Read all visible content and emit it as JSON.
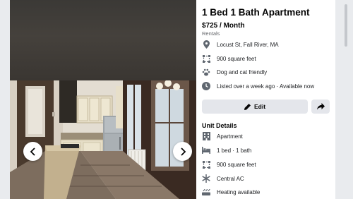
{
  "listing": {
    "title": "1 Bed 1 Bath Apartment",
    "price": "$725 / Month",
    "category": "Rentals"
  },
  "summary": [
    {
      "icon": "location-pin-icon",
      "text": "Locust St, Fall River, MA"
    },
    {
      "icon": "square-footage-icon",
      "text": "900 square feet"
    },
    {
      "icon": "paw-icon",
      "text": "Dog and cat friendly"
    },
    {
      "icon": "clock-icon",
      "text": "Listed over a week ago · Available now"
    }
  ],
  "actions": {
    "edit_label": "Edit",
    "share_icon": "share-arrow-icon"
  },
  "unit_details": {
    "title": "Unit Details",
    "items": [
      {
        "icon": "apartment-building-icon",
        "text": "Apartment"
      },
      {
        "icon": "bed-icon",
        "text": "1 bed · 1 bath"
      },
      {
        "icon": "square-footage-icon",
        "text": "900 square feet"
      },
      {
        "icon": "snowflake-icon",
        "text": "Central AC"
      },
      {
        "icon": "heater-icon",
        "text": "Heating available"
      }
    ]
  },
  "colors": {
    "page_background": "#e9ebee",
    "panel_background": "#ffffff",
    "button_background": "#e4e6eb",
    "icon_color": "#606770",
    "text_primary": "#050505",
    "text_secondary": "#65676b"
  }
}
